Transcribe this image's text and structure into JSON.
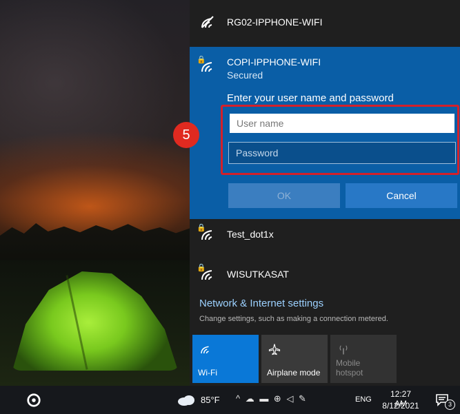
{
  "networks": {
    "top": {
      "ssid": "RG02-IPPHONE-WIFI",
      "icon": "wifi-icon"
    },
    "selected": {
      "ssid": "COPI-IPPHONE-WIFI",
      "status": "Secured",
      "prompt": "Enter your user name and password",
      "username_placeholder": "User name",
      "password_placeholder": "Password",
      "ok_label": "OK",
      "cancel_label": "Cancel"
    },
    "others": [
      {
        "ssid": "Test_dot1x",
        "icon": "secured-wifi-icon"
      },
      {
        "ssid": "WISUTKASAT",
        "icon": "secured-wifi-icon"
      }
    ]
  },
  "settings": {
    "title": "Network & Internet settings",
    "subtitle": "Change settings, such as making a connection metered."
  },
  "quick_actions": [
    {
      "label": "Wi-Fi",
      "icon": "wifi-icon",
      "active": true
    },
    {
      "label": "Airplane mode",
      "icon": "airplane-icon",
      "active": false
    },
    {
      "label": "Mobile hotspot",
      "icon": "hotspot-icon",
      "active": false
    }
  ],
  "annotation": {
    "step": "5",
    "color": "#d4202a"
  },
  "taskbar": {
    "temperature": "85°F",
    "language": "ENG",
    "time": "12:27 AM",
    "date": "8/12/2021",
    "notification_count": "3"
  },
  "colors": {
    "accent": "#0a5ea6",
    "tile_active": "#0a78d7",
    "link": "#9cd1ff"
  }
}
